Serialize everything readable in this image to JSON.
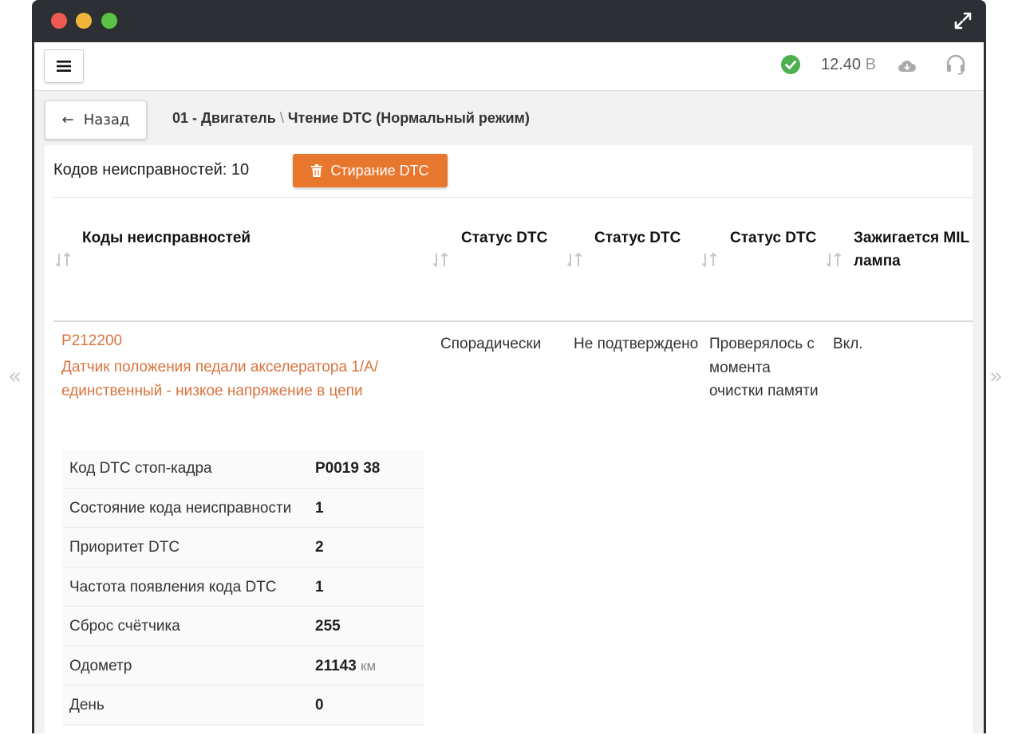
{
  "header": {
    "voltage": "12.40",
    "voltage_unit": "В"
  },
  "crumbs": {
    "back_label": "Назад",
    "path": "01 - Двигатель",
    "separator": "\\",
    "current": "Чтение DTC (Нормальный режим)"
  },
  "summary": {
    "count_label": "Кодов неисправностей: 10",
    "erase_label": "Стирание DTC"
  },
  "table": {
    "headers": [
      "Коды неисправностей",
      "Статус DTC",
      "Статус DTC",
      "Статус DTC",
      "Зажигается MIL лампа"
    ],
    "row": {
      "code": "P212200",
      "description": "Датчик положения педали акселератора 1/A/единственный - низкое напряжение в цепи",
      "status1": "Спорадически",
      "status2": "Не подтверждено",
      "status3": "Проверялось с момента очистки памяти",
      "mil": "Вкл."
    }
  },
  "freeze_frame": [
    {
      "label": "Код DTC стоп-кадра",
      "value": "P0019 38",
      "unit": ""
    },
    {
      "label": "Состояние кода неисправности",
      "value": "1",
      "unit": ""
    },
    {
      "label": "Приоритет DTC",
      "value": "2",
      "unit": ""
    },
    {
      "label": "Частота появления кода DTC",
      "value": "1",
      "unit": ""
    },
    {
      "label": "Сброс счётчика",
      "value": "255",
      "unit": ""
    },
    {
      "label": "Одометр",
      "value": "21143",
      "unit": "км"
    },
    {
      "label": "День",
      "value": "0",
      "unit": ""
    }
  ],
  "colors": {
    "accent": "#e8772e",
    "link": "#d9733f",
    "ok": "#4caf50"
  },
  "icons": [
    "menu-icon",
    "check-circle-icon",
    "cloud-icon",
    "headset-icon",
    "arrow-left-icon",
    "trash-icon",
    "sort-icon",
    "expand-icon"
  ]
}
